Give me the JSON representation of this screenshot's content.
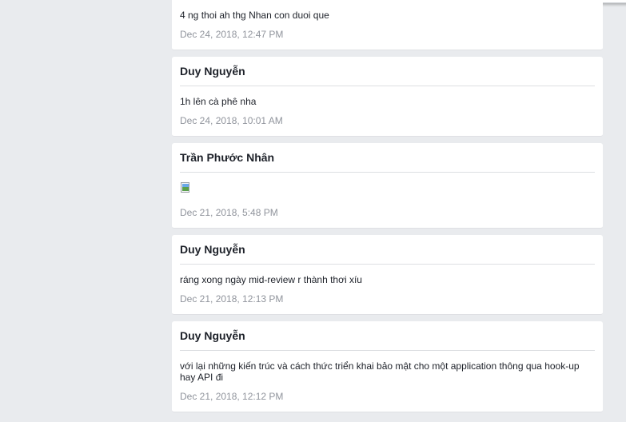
{
  "posts": [
    {
      "author": "",
      "message": "4 ng thoi ah thg Nhan con duoi que",
      "timestamp": "Dec 24, 2018, 12:47 PM",
      "has_image": false
    },
    {
      "author": "Duy Nguyễn",
      "message": "1h lên cà phê nha",
      "timestamp": "Dec 24, 2018, 10:01 AM",
      "has_image": false
    },
    {
      "author": "Trần Phước Nhân",
      "message": "",
      "timestamp": "Dec 21, 2018, 5:48 PM",
      "has_image": true,
      "image_icon": "broken-image-icon"
    },
    {
      "author": "Duy Nguyễn",
      "message": "ráng xong ngày mid-review r thành thơi xíu",
      "timestamp": "Dec 21, 2018, 12:13 PM",
      "has_image": false
    },
    {
      "author": "Duy Nguyễn",
      "message": "với lại những kiến trúc và cách thức triển khai bảo mật cho một application thông qua hook-up hay API đi",
      "timestamp": "Dec 21, 2018, 12:12 PM",
      "has_image": false
    }
  ],
  "colors": {
    "background": "#e9ebee",
    "card": "#ffffff",
    "text": "#1d2129",
    "timestamp": "#90949c",
    "divider": "#dddfe2"
  }
}
